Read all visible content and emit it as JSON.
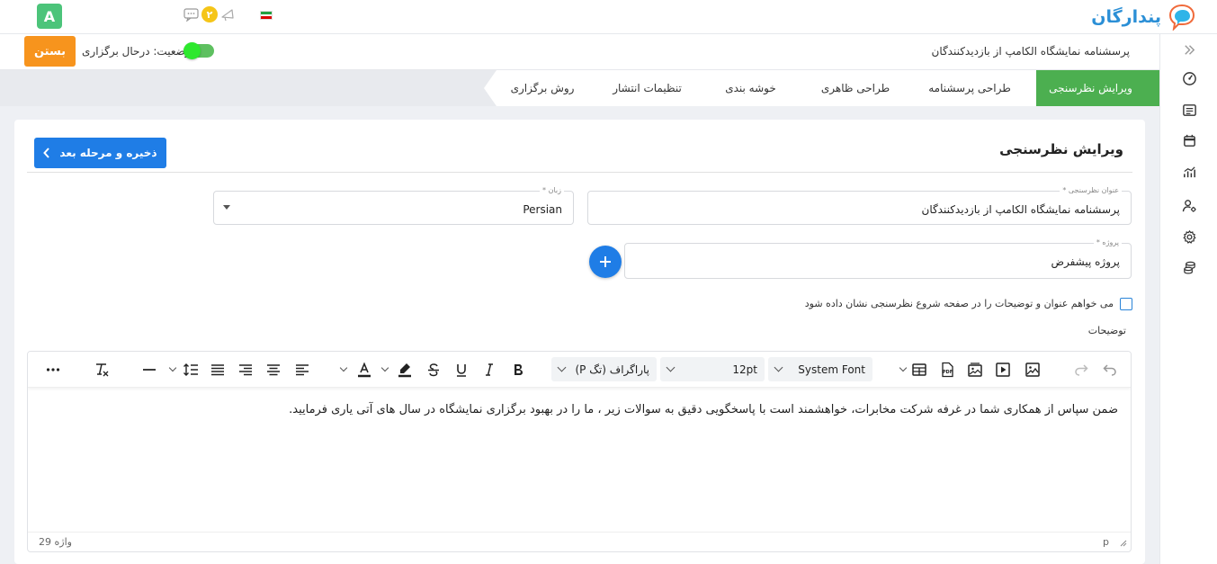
{
  "app": {
    "logo_text": "پندارگان",
    "avatar_letter": "A",
    "notification_count": "۲"
  },
  "colors": {
    "accent": "#1f7de6",
    "active_step": "#4caf50",
    "close_button": "#f7941d",
    "logo": "#2b8fd6"
  },
  "status_bar": {
    "survey_title": "پرسشنامه نمایشگاه الکامپ از بازدیدکنندگان",
    "status_text": "وضعیت: درحال برگزاری",
    "close_label": "بستن"
  },
  "steps": [
    {
      "label": "ویرایش نظرسنجی",
      "active": true
    },
    {
      "label": "طراحی پرسشنامه",
      "active": false
    },
    {
      "label": "طراحی ظاهری",
      "active": false
    },
    {
      "label": "خوشه بندی",
      "active": false
    },
    {
      "label": "تنظیمات انتشار",
      "active": false
    },
    {
      "label": "روش برگزاری",
      "active": false
    }
  ],
  "card": {
    "title": "ویرایش نظرسنجی",
    "save_label": "ذخیره و مرحله بعد"
  },
  "fields": {
    "survey_title": {
      "label": "عنوان نظرسنجی *",
      "value": "پرسشنامه نمایشگاه الکامپ از بازدیدکنندگان"
    },
    "language": {
      "label": "زبان *",
      "value": "Persian"
    },
    "project": {
      "label": "پروژه *",
      "value": "پروژه پیشفرض"
    }
  },
  "checkbox_label": "می خواهم عنوان و توضیحات را در صفحه شروع نظرسنجی نشان داده شود",
  "description_label": "توضیحات",
  "editor": {
    "font_family": "System Font",
    "font_size": "12pt",
    "block_format": "پاراگراف (تگ P)",
    "content": "ضمن سپاس از همکاری شما در غرفه شرکت مخابرات، خواهشمند است با پاسخگویی دقیق به سوالات زیر ، ما را در بهبود برگزاری نمایشگاه در سال های آتی یاری فرمایید.",
    "word_count": "29 واژه",
    "path": "p"
  },
  "sidebar_icons": [
    "collapse-icon",
    "dashboard-icon",
    "list-icon",
    "calendar-icon",
    "chart-icon",
    "user-settings-icon",
    "gear-icon",
    "database-icon"
  ]
}
